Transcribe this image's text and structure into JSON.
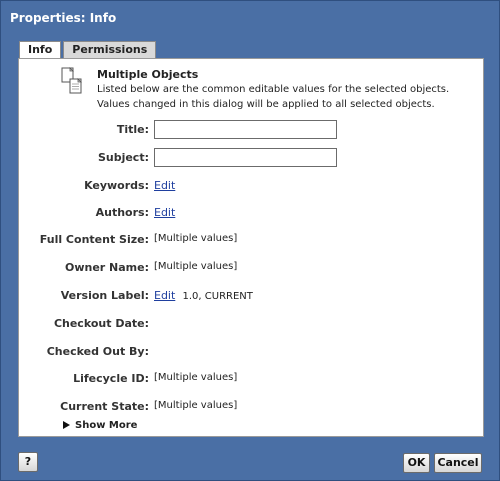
{
  "window": {
    "title": "Properties: Info"
  },
  "tabs": [
    {
      "label": "Info",
      "active": true
    },
    {
      "label": "Permissions",
      "active": false
    }
  ],
  "header": {
    "icon": "multiple-documents-icon",
    "title": "Multiple Objects",
    "line1": "Listed below are the common editable values for the selected objects.",
    "line2": "Values changed in this dialog will be applied to all selected objects."
  },
  "fields": {
    "title": {
      "label": "Title:",
      "value": ""
    },
    "subject": {
      "label": "Subject:",
      "value": ""
    },
    "keywords": {
      "label": "Keywords:",
      "link": "Edit"
    },
    "authors": {
      "label": "Authors:",
      "link": "Edit"
    },
    "full_content_size": {
      "label": "Full Content Size:",
      "value": "[Multiple values]"
    },
    "owner_name": {
      "label": "Owner Name:",
      "value": "[Multiple values]"
    },
    "version_label": {
      "label": "Version Label:",
      "link": "Edit",
      "value": "1.0, CURRENT"
    },
    "checkout_date": {
      "label": "Checkout Date:",
      "value": ""
    },
    "checked_out_by": {
      "label": "Checked Out By:",
      "value": ""
    },
    "lifecycle_id": {
      "label": "Lifecycle ID:",
      "value": "[Multiple values]"
    },
    "current_state": {
      "label": "Current State:",
      "value": "[Multiple values]"
    }
  },
  "show_more": "Show More",
  "buttons": {
    "help": "?",
    "ok": "OK",
    "cancel": "Cancel"
  }
}
